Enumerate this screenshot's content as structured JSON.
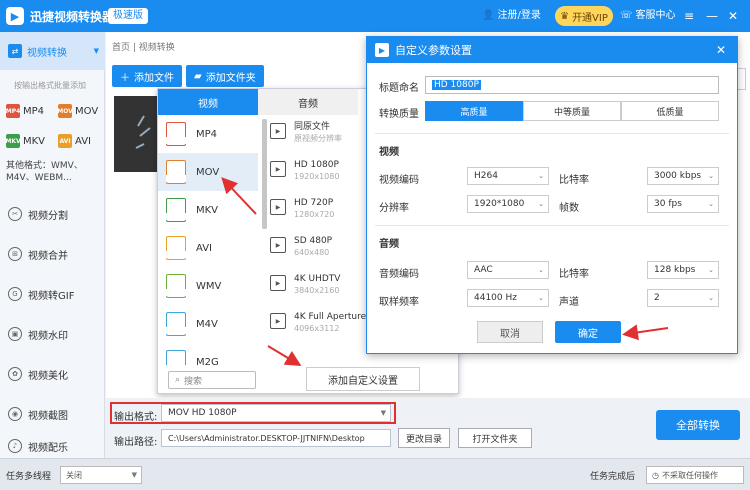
{
  "app": {
    "title": "迅捷视频转换器",
    "badge": "极速版",
    "login": "注册/登录",
    "vip": "开通VIP",
    "service": "客服中心"
  },
  "sidebar": {
    "convert": "视频转换",
    "batch_note": "按输出格式批量添加",
    "formats": [
      "MP4",
      "MOV",
      "MKV",
      "AVI"
    ],
    "other_formats": "其他格式：WMV、M4V、WEBM...",
    "tools": [
      "视频分割",
      "视频合并",
      "视频转GIF",
      "视频水印",
      "视频美化",
      "视频截图",
      "视频配乐"
    ]
  },
  "main": {
    "breadcrumb": "首页 | 视频转换",
    "add_file": "添加文件",
    "add_folder": "添加文件夹",
    "right_edge_text": "改音"
  },
  "format_popup": {
    "tabs": [
      "视频",
      "音频"
    ],
    "formats": [
      "MP4",
      "MOV",
      "MKV",
      "AVI",
      "WMV",
      "M4V",
      "M2G"
    ],
    "selected_format": "MOV",
    "search_placeholder": "搜索",
    "resolutions": [
      {
        "name": "同原文件",
        "sub": "原视频分辨率"
      },
      {
        "name": "HD 1080P",
        "sub": "1920x1080"
      },
      {
        "name": "HD 720P",
        "sub": "1280x720"
      },
      {
        "name": "SD 480P",
        "sub": "640x480"
      },
      {
        "name": "4K UHDTV",
        "sub": "3840x2160"
      },
      {
        "name": "4K Full Aperture",
        "sub": "4096x3112"
      }
    ],
    "add_custom": "添加自定义设置"
  },
  "output": {
    "format_label": "输出格式:",
    "format_value": "MOV  HD 1080P",
    "path_label": "输出路径:",
    "path_value": "C:\\Users\\Administrator.DESKTOP-JJTNIFN\\Desktop",
    "change_dir": "更改目录",
    "open_folder": "打开文件夹",
    "convert_all": "全部转换"
  },
  "statusbar": {
    "multithread_label": "任务多线程",
    "multithread_value": "关闭",
    "done_label": "任务完成后",
    "done_value": "不采取任何操作"
  },
  "dialog": {
    "title": "自定义参数设置",
    "name_label": "标题命名",
    "name_value": "HD 1080P",
    "quality_label": "转换质量",
    "quality_options": [
      "高质量",
      "中等质量",
      "低质量"
    ],
    "quality_selected": "高质量",
    "video_section": "视频",
    "video_codec_label": "视频编码",
    "video_codec": "H264",
    "video_bitrate_label": "比特率",
    "video_bitrate": "3000 kbps",
    "resolution_label": "分辨率",
    "resolution": "1920*1080",
    "fps_label": "帧数",
    "fps": "30 fps",
    "audio_section": "音频",
    "audio_codec_label": "音频编码",
    "audio_codec": "AAC",
    "audio_bitrate_label": "比特率",
    "audio_bitrate": "128 kbps",
    "sample_rate_label": "取样频率",
    "sample_rate": "44100 Hz",
    "channels_label": "声道",
    "channels": "2",
    "cancel": "取消",
    "ok": "确定"
  },
  "colors": {
    "accent": "#1a8cf0",
    "annotation": "#e03030",
    "vip": "#ffd65c"
  }
}
